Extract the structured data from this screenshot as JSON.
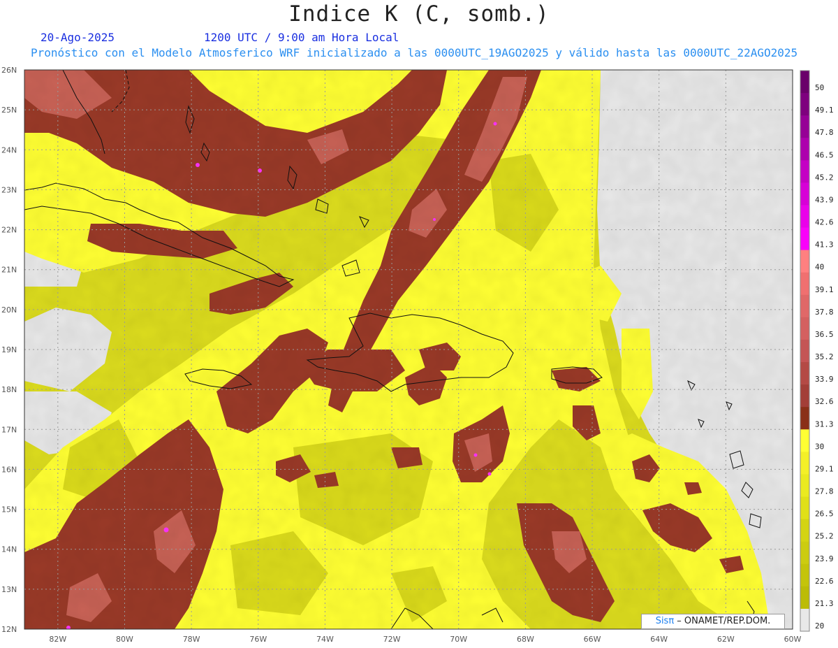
{
  "header": {
    "title": "Indice K (C, somb.)",
    "date": "20-Ago-2025",
    "time": "1200 UTC / 9:00 am Hora Local",
    "forecast": "Pronóstico con el Modelo Atmosferico WRF inicializado a las 0000UTC_19AGO2025 y válido hasta las  0000UTC_22AGO2025"
  },
  "map": {
    "lon_range": [
      -83.0,
      -60.0
    ],
    "lat_range": [
      12.0,
      26.0
    ],
    "lat_labels": [
      "26N",
      "25N",
      "24N",
      "23N",
      "22N",
      "21N",
      "20N",
      "19N",
      "18N",
      "17N",
      "16N",
      "15N",
      "14N",
      "13N",
      "12N"
    ],
    "lon_labels": [
      "82W",
      "80W",
      "78W",
      "76W",
      "74W",
      "72W",
      "70W",
      "68W",
      "66W",
      "64W",
      "62W",
      "60W"
    ]
  },
  "legend": {
    "labels": [
      "50",
      "49.1",
      "47.8",
      "46.5",
      "45.2",
      "43.9",
      "42.6",
      "41.3",
      "40",
      "39.1",
      "37.8",
      "36.5",
      "35.2",
      "33.9",
      "32.6",
      "31.3",
      "30",
      "29.1",
      "27.8",
      "26.5",
      "25.2",
      "23.9",
      "22.6",
      "21.3",
      "20"
    ],
    "colors": [
      "#6a006a",
      "#7e007e",
      "#960096",
      "#ad00ad",
      "#c400c4",
      "#d700d7",
      "#ea00ea",
      "#fa00fa",
      "#ff8080",
      "#f07070",
      "#e06868",
      "#d46060",
      "#c45555",
      "#b44a45",
      "#a33f38",
      "#8a3018",
      "#ffff33",
      "#f4f028",
      "#eaea20",
      "#e0e018",
      "#d4d412",
      "#cccc10",
      "#c4c40a",
      "#bcbc06",
      "#e8e8e8"
    ]
  },
  "credit": {
    "sis": "Sisπ",
    "rest": " – ONAMET/REP.DOM."
  }
}
